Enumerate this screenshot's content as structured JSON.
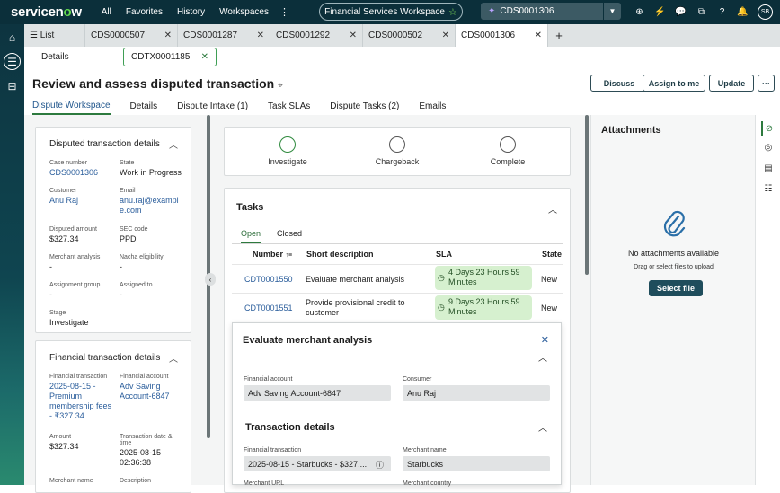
{
  "topbar": {
    "logo_pre": "servicen",
    "logo_o": "o",
    "logo_post": "w",
    "nav": [
      "All",
      "Favorites",
      "History",
      "Workspaces"
    ],
    "kebab": "⋮",
    "workspace": "Financial Services Workspace",
    "search_value": "CDS0001306",
    "avatar": "SB"
  },
  "tabs": {
    "list_label": "List",
    "items": [
      "CDS0000507",
      "CDS0001287",
      "CDS0001292",
      "CDS0000502",
      "CDS0001306"
    ],
    "active_index": 4,
    "plus": "+"
  },
  "subtabs": {
    "details": "Details",
    "record": "CDTX0001185"
  },
  "header": {
    "title": "Review and assess disputed transaction",
    "buttons": [
      "Discuss",
      "Assign to me",
      "Update"
    ],
    "more": "···",
    "record_tabs": [
      "Dispute Workspace",
      "Details",
      "Dispute Intake (1)",
      "Task SLAs",
      "Dispute Tasks (2)",
      "Emails"
    ]
  },
  "disputed_card": {
    "title": "Disputed transaction details",
    "fields": [
      {
        "label": "Case number",
        "value": "CDS0001306",
        "link": true
      },
      {
        "label": "State",
        "value": "Work in Progress",
        "link": false
      },
      {
        "label": "Customer",
        "value": "Anu Raj",
        "link": true
      },
      {
        "label": "Email",
        "value": "anu.raj@example.com",
        "link": true
      },
      {
        "label": "Disputed amount",
        "value": "$327.34",
        "link": false
      },
      {
        "label": "SEC code",
        "value": "PPD",
        "link": false
      },
      {
        "label": "Merchant analysis",
        "value": "-",
        "link": false
      },
      {
        "label": "Nacha eligibility",
        "value": "-",
        "link": false
      },
      {
        "label": "Assignment group",
        "value": "-",
        "link": false
      },
      {
        "label": "Assigned to",
        "value": "-",
        "link": false
      },
      {
        "label": "Stage",
        "value": "Investigate",
        "link": false
      }
    ]
  },
  "financial_card": {
    "title": "Financial transaction details",
    "fields": [
      {
        "label": "Financial transaction",
        "value": "2025-08-15 - Premium membership fees - ₹327.34",
        "link": true
      },
      {
        "label": "Financial account",
        "value": "Adv Saving Account-6847",
        "link": true
      },
      {
        "label": "Amount",
        "value": "$327.34",
        "link": false
      },
      {
        "label": "Transaction date & time",
        "value": "2025-08-15 02:36:38",
        "link": false
      },
      {
        "label": "Merchant name",
        "value": "",
        "link": false
      },
      {
        "label": "Description",
        "value": "",
        "link": false
      }
    ]
  },
  "stages": [
    "Investigate",
    "Chargeback",
    "Complete"
  ],
  "tasks": {
    "title": "Tasks",
    "tabs": [
      "Open",
      "Closed"
    ],
    "columns": [
      "Number",
      "Short description",
      "SLA",
      "State"
    ],
    "sort_indicator": "↑≡",
    "rows": [
      {
        "number": "CDT0001550",
        "desc": "Evaluate merchant analysis",
        "sla": "4 Days 23 Hours 59 Minutes",
        "state": "New"
      },
      {
        "number": "CDT0001551",
        "desc": "Provide provisional credit to customer",
        "sla": "9 Days 23 Hours 59 Minutes",
        "state": "New"
      }
    ]
  },
  "overlay": {
    "title": "Evaluate merchant analysis",
    "fin_account_label": "Financial account",
    "fin_account_value": "Adv Saving Account-6847",
    "consumer_label": "Consumer",
    "consumer_value": "Anu Raj",
    "section": "Transaction details",
    "fin_tx_label": "Financial transaction",
    "fin_tx_value": "2025-08-15 - Starbucks - $327....",
    "merchant_label": "Merchant name",
    "merchant_value": "Starbucks",
    "more_left_label": "Merchant URL",
    "more_right_label": "Merchant country"
  },
  "attachments": {
    "title": "Attachments",
    "empty": "No attachments available",
    "hint": "Drag or select files to upload",
    "button": "Select file"
  }
}
